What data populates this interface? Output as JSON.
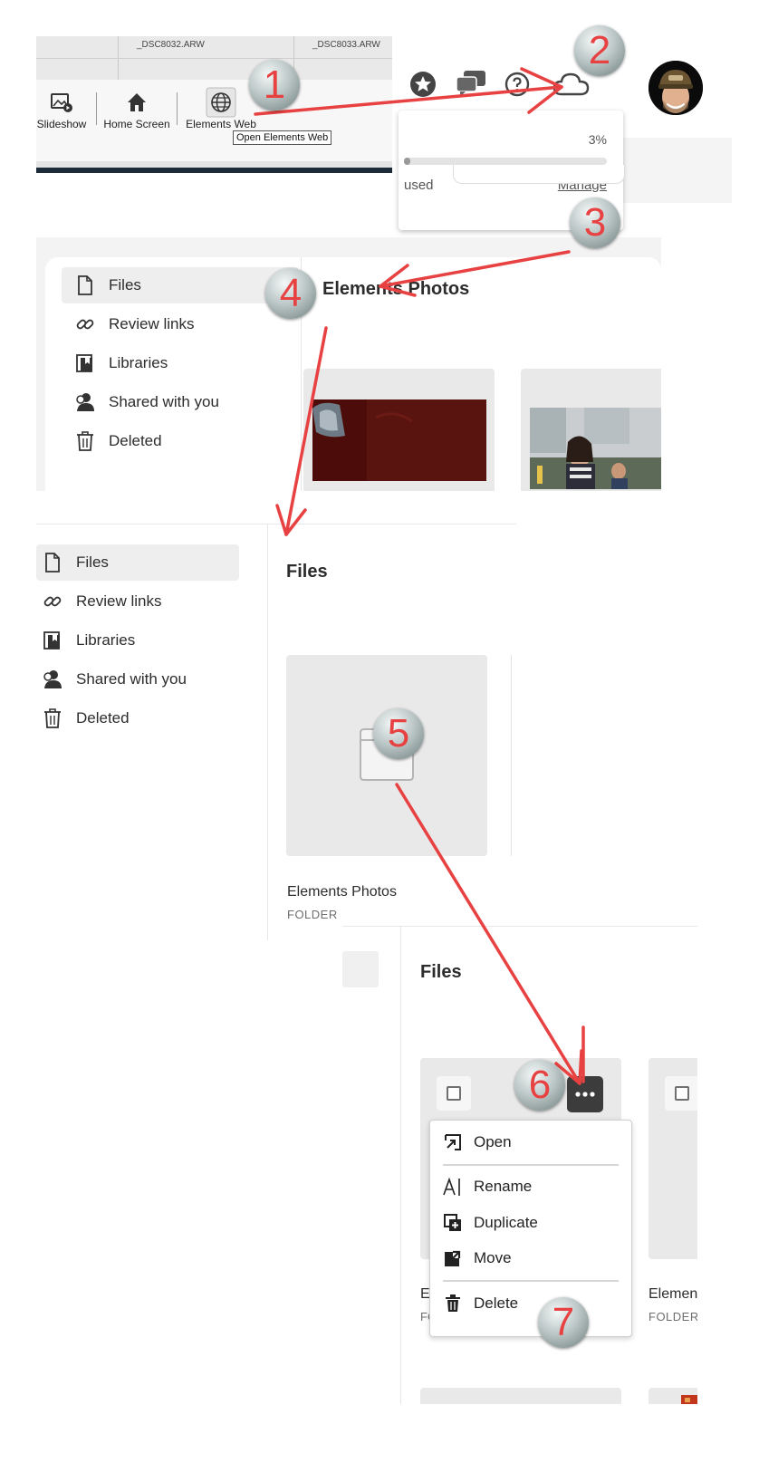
{
  "toolbar": {
    "file_names": [
      "_DSC8032.ARW",
      "_DSC8033.ARW"
    ],
    "items": [
      {
        "label": "Slideshow",
        "icon": "slideshow-icon"
      },
      {
        "label": "Home Screen",
        "icon": "home-icon"
      },
      {
        "label": "Elements Web",
        "icon": "globe-icon"
      }
    ],
    "tooltip": "Open Elements Web"
  },
  "cloud_dropdown": {
    "icons": [
      "star-icon",
      "chat-icon",
      "help-icon",
      "cloud-icon"
    ],
    "percent": "3%",
    "storage_fraction": 0.03,
    "used_label": "used",
    "manage_label": "Manage"
  },
  "sidebar": {
    "items": [
      {
        "label": "Files",
        "icon": "file-icon",
        "selected": true
      },
      {
        "label": "Review links",
        "icon": "link-icon"
      },
      {
        "label": "Libraries",
        "icon": "libraries-icon"
      },
      {
        "label": "Shared with you",
        "icon": "shared-user-icon"
      },
      {
        "label": "Deleted",
        "icon": "trash-icon"
      }
    ]
  },
  "folder_view": {
    "back_icon": "chevron-left-icon",
    "title": "Elements Photos"
  },
  "files_view": {
    "title": "Files",
    "folder_name": "Elements Photos",
    "folder_type": "FOLDER"
  },
  "menu_view": {
    "title": "Files",
    "card1_name": "E",
    "card1_type": "FOL",
    "card2_name": "Elemen",
    "card2_type": "FOLDER",
    "more_icon": "more-icon",
    "menu": [
      {
        "label": "Open",
        "icon": "open-icon"
      },
      {
        "label": "Rename",
        "icon": "rename-icon"
      },
      {
        "label": "Duplicate",
        "icon": "duplicate-icon"
      },
      {
        "label": "Move",
        "icon": "move-icon"
      },
      {
        "label": "Delete",
        "icon": "delete-icon"
      }
    ]
  },
  "steps": [
    "1",
    "2",
    "3",
    "4",
    "5",
    "6",
    "7"
  ],
  "colors": {
    "annotation": "#e84141",
    "badge": "#b5c1c1",
    "selected_nav": "#eeeeee",
    "more_button": "#3c3c3c"
  }
}
